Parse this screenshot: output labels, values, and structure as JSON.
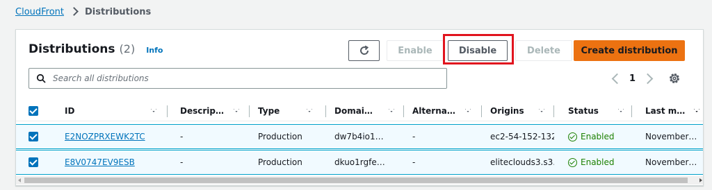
{
  "breadcrumb": {
    "root": "CloudFront",
    "current": "Distributions"
  },
  "panel": {
    "title": "Distributions",
    "count": "(2)",
    "info": "Info"
  },
  "toolbar": {
    "refresh_icon": "refresh-icon",
    "enable_label": "Enable",
    "disable_label": "Disable",
    "delete_label": "Delete",
    "create_label": "Create distribution"
  },
  "search": {
    "placeholder": "Search all distributions"
  },
  "pagination": {
    "current_page": "1"
  },
  "table": {
    "columns": [
      "ID",
      "Descrip…",
      "Type",
      "Domai…",
      "Alterna…",
      "Origins",
      "Status",
      "Last m…"
    ],
    "rows": [
      {
        "id": "E2NOZPRXEWK2TC",
        "description": "-",
        "type": "Production",
        "domain": "dw7b4io1…",
        "alternate": "-",
        "origins": "ec2-54-152-132",
        "status": "Enabled",
        "last_modified": "November…"
      },
      {
        "id": "E8V0747EV9ESB",
        "description": "-",
        "type": "Production",
        "domain": "dkuo1rgfe…",
        "alternate": "-",
        "origins": "eliteclouds3.s3.",
        "status": "Enabled",
        "last_modified": "November…"
      }
    ]
  },
  "colors": {
    "link": "#0073bb",
    "primary_button": "#ec7211",
    "selected_row": "#f1faff",
    "status_enabled": "#1d8102",
    "highlight_box": "#e1141e"
  }
}
